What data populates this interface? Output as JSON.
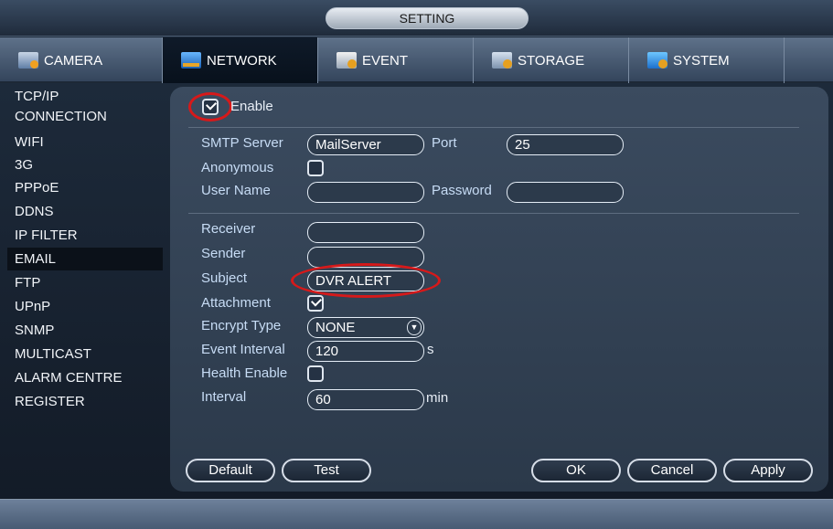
{
  "window": {
    "title": "SETTING"
  },
  "tabs": [
    {
      "label": "CAMERA",
      "icon": "camera-icon"
    },
    {
      "label": "NETWORK",
      "icon": "network-icon"
    },
    {
      "label": "EVENT",
      "icon": "event-icon"
    },
    {
      "label": "STORAGE",
      "icon": "storage-icon"
    },
    {
      "label": "SYSTEM",
      "icon": "system-icon"
    }
  ],
  "sidebar": {
    "items": [
      {
        "label": "TCP/IP"
      },
      {
        "label": "CONNECTION"
      },
      {
        "label": "WIFI"
      },
      {
        "label": "3G"
      },
      {
        "label": "PPPoE"
      },
      {
        "label": "DDNS"
      },
      {
        "label": "IP FILTER"
      },
      {
        "label": "EMAIL"
      },
      {
        "label": "FTP"
      },
      {
        "label": "UPnP"
      },
      {
        "label": "SNMP"
      },
      {
        "label": "MULTICAST"
      },
      {
        "label": "ALARM CENTRE"
      },
      {
        "label": "REGISTER"
      }
    ]
  },
  "email": {
    "enable_label": "Enable",
    "enable_checked": true,
    "smtp_label": "SMTP Server",
    "smtp_value": "MailServer",
    "port_label": "Port",
    "port_value": "25",
    "anonymous_label": "Anonymous",
    "anonymous_checked": false,
    "username_label": "User Name",
    "username_value": "",
    "password_label": "Password",
    "password_value": "",
    "receiver_label": "Receiver",
    "receiver_value": "",
    "sender_label": "Sender",
    "sender_value": "",
    "subject_label": "Subject",
    "subject_value": "DVR ALERT",
    "attachment_label": "Attachment",
    "attachment_checked": true,
    "encrypt_label": "Encrypt Type",
    "encrypt_value": "NONE",
    "event_interval_label": "Event Interval",
    "event_interval_value": "120",
    "event_interval_unit": "s",
    "health_label": "Health Enable",
    "health_checked": false,
    "interval_label": "Interval",
    "interval_value": "60",
    "interval_unit": "min"
  },
  "buttons": {
    "default": "Default",
    "test": "Test",
    "ok": "OK",
    "cancel": "Cancel",
    "apply": "Apply"
  },
  "colors": {
    "annotation_ring": "#d6191a",
    "label_text": "#c7dcf5"
  }
}
